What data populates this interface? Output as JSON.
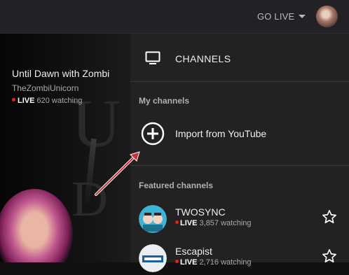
{
  "topbar": {
    "go_live_label": "GO LIVE",
    "avatar_icon": "user-avatar"
  },
  "background_stream": {
    "title": "Until Dawn with Zombi",
    "channel": "TheZombiUnicorn",
    "live_label": "LIVE",
    "watching": "620 watching"
  },
  "drawer": {
    "header_title": "CHANNELS",
    "header_icon": "tv-icon",
    "my_channels_label": "My channels",
    "import_label": "Import from YouTube",
    "import_icon": "plus-circle-icon",
    "featured_label": "Featured channels",
    "featured": [
      {
        "name": "TWOSYNC",
        "live": "LIVE",
        "watching": "3,857 watching"
      },
      {
        "name": "Escapist",
        "live": "LIVE",
        "watching": "2,716 watching"
      }
    ]
  },
  "colors": {
    "live_dot": "#e62117",
    "drawer_bg": "#222222",
    "annotation_arrow": "#c8303a"
  }
}
